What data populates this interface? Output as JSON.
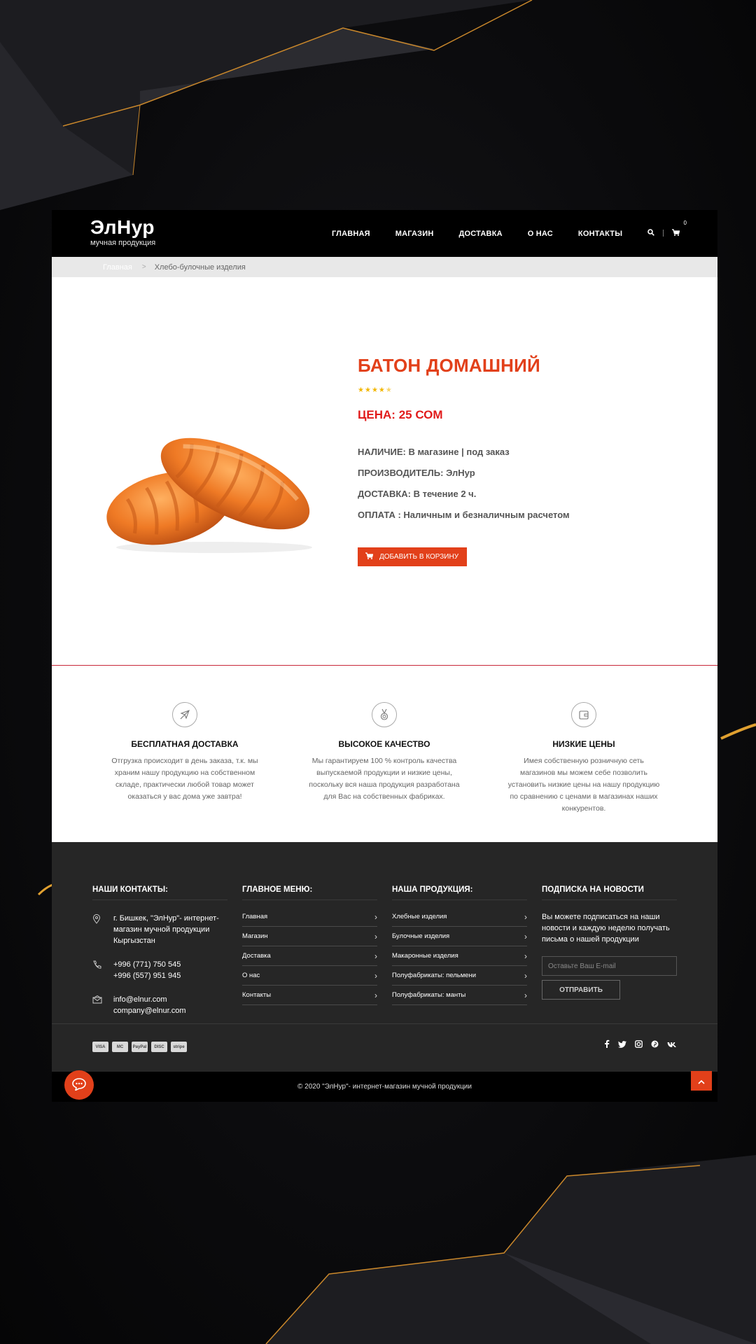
{
  "brand": {
    "name": "ЭлНур",
    "tagline": "мучная продукция"
  },
  "nav": [
    "ГЛАВНАЯ",
    "МАГАЗИН",
    "ДОСТАВКА",
    "О НАС",
    "КОНТАКТЫ"
  ],
  "cart": {
    "count": "0"
  },
  "breadcrumb": {
    "home": "Главная",
    "current": "Хлебо-булочные изделия"
  },
  "product": {
    "title": "БАТОН ДОМАШНИЙ",
    "rating_stars": 4.5,
    "price": "ЦЕНА: 25 СОМ",
    "specs": [
      "НАЛИЧИЕ: В магазине | под заказ",
      "ПРОИЗВОДИТЕЛЬ: ЭлНур",
      "ДОСТАВКА: В течение 2 ч.",
      "ОПЛАТА : Наличным и безналичным расчетом"
    ],
    "add_to_cart": "ДОБАВИТЬ В КОРЗИНУ"
  },
  "features": [
    {
      "icon": "airplane-icon",
      "title": "БЕСПЛАТНАЯ ДОСТАВКА",
      "text": "Отгрузка происходит в день заказа, т.к. мы храним нашу продукцию на собственном складе, практически любой товар может оказаться у вас дома уже завтра!"
    },
    {
      "icon": "medal-icon",
      "title": "ВЫСОКОЕ КАЧЕСТВО",
      "text": "Мы гарантируем 100 % контроль качества выпускаемой продукции и низкие цены, поскольку вся наша продукция разработана для Вас на собственных фабриках."
    },
    {
      "icon": "wallet-icon",
      "title": "НИЗКИЕ ЦЕНЫ",
      "text": "Имея собственную розничную сеть магазинов мы можем себе позволить установить низкие цены на нашу продукцию по сравнению с ценами в магазинах наших конкурентов."
    }
  ],
  "footer": {
    "contacts_title": "НАШИ КОНТАКТЫ:",
    "address": "г. Бишкек, \"ЭлНур\"- интернет-магазин мучной продукции Кыргызстан",
    "phone1": "+996 (771) 750 545",
    "phone2": "+996 (557) 951 945",
    "email1": "info@elnur.com",
    "email2": "company@elnur.com",
    "menu_title": "ГЛАВНОЕ МЕНЮ:",
    "menu": [
      "Главная",
      "Магазин",
      "Доставка",
      "О нас",
      "Контакты"
    ],
    "products_title": "НАША ПРОДУКЦИЯ:",
    "products": [
      "Хлебные изделия",
      "Булочные изделия",
      "Макаронные изделия",
      "Полуфабрикаты: пельмени",
      "Полуфабрикаты: манты"
    ],
    "subscribe_title": "ПОДПИСКА НА НОВОСТИ",
    "subscribe_text": "Вы можете подписаться на наши новости и каждую неделю получать письма о нашей продукции",
    "email_placeholder": "Оставьте Ваш E-mail",
    "subscribe_button": "ОТПРАВИТЬ",
    "payments": [
      "VISA",
      "MC",
      "PayPal",
      "DISC",
      "stripe"
    ],
    "socials": [
      "facebook-icon",
      "twitter-icon",
      "instagram-icon",
      "pinterest-icon",
      "vk-icon"
    ],
    "copyright": "© 2020 \"ЭлНур\"- интернет-магазин мучной продукции"
  },
  "colors": {
    "accent": "#e2401a",
    "price": "#e11b1b",
    "stars": "#f2b705",
    "footer_bg": "#262626"
  }
}
